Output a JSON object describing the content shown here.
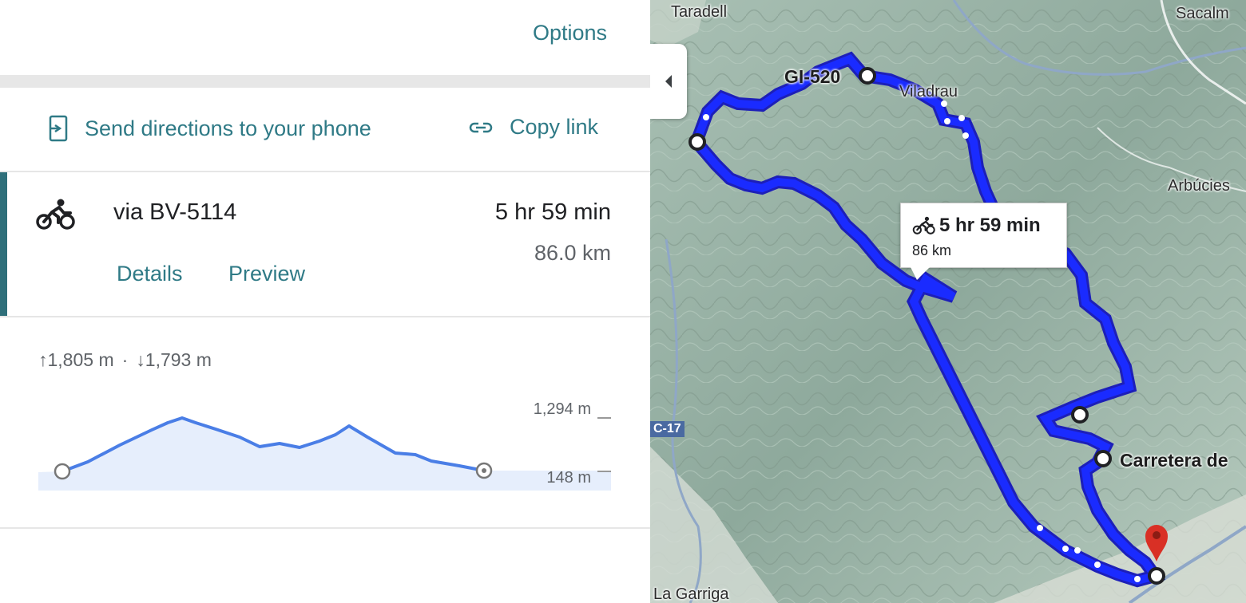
{
  "panel": {
    "options_label": "Options",
    "send_directions_label": "Send directions to your phone",
    "copy_link_label": "Copy link",
    "route": {
      "via": "via BV-5114",
      "duration": "5 hr 59 min",
      "distance": "86.0 km",
      "details_label": "Details",
      "preview_label": "Preview"
    },
    "elevation": {
      "ascent": "1,805 m",
      "descent": "1,793 m",
      "separator": "·",
      "max_label": "1,294 m",
      "min_label": "148 m"
    }
  },
  "map": {
    "labels": {
      "taradell": "Taradell",
      "sacalm": "Sacalm",
      "gi520": "GI-520",
      "viladrau": "Viladrau",
      "arbucies": "Arbúcies",
      "carretera": "Carretera de",
      "la_garriga": "La Garriga"
    },
    "road_badge": "C-17",
    "tooltip": {
      "duration": "5 hr 59 min",
      "distance": "86 km"
    },
    "colors": {
      "route": "#1a2bff",
      "route_outline": "#1d1fb8",
      "terrain": "#9fb7ab",
      "pin": "#d93025"
    }
  },
  "icons": {
    "transport_mode": "bicycle-icon",
    "send_to_phone": "phone-send-icon",
    "copy_link": "link-icon",
    "collapse": "chevron-left-icon",
    "destination": "map-pin-icon"
  }
}
